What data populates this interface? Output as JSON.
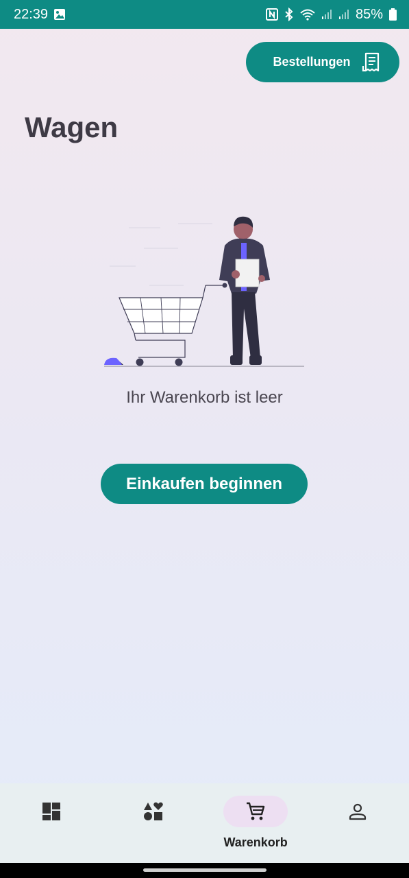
{
  "status_bar": {
    "time": "22:39",
    "battery": "85%",
    "icons": [
      "image-icon",
      "nfc-icon",
      "bluetooth-icon",
      "wifi-icon",
      "signal-icon",
      "signal-icon",
      "battery-icon"
    ]
  },
  "header": {
    "orders_label": "Bestellungen",
    "orders_icon": "receipt-icon"
  },
  "page": {
    "title": "Wagen",
    "empty_message": "Ihr Warenkorb ist leer",
    "start_button": "Einkaufen beginnen",
    "illustration": "empty-cart-illustration"
  },
  "nav": {
    "items": [
      {
        "icon": "dashboard-icon",
        "label": ""
      },
      {
        "icon": "categories-icon",
        "label": ""
      },
      {
        "icon": "cart-icon",
        "label": "Warenkorb",
        "active": true
      },
      {
        "icon": "person-icon",
        "label": ""
      }
    ]
  },
  "colors": {
    "accent": "#0e8b84",
    "title_text": "#3e3a45",
    "nav_background": "#e8eff1",
    "active_indicator": "#eddff2"
  }
}
